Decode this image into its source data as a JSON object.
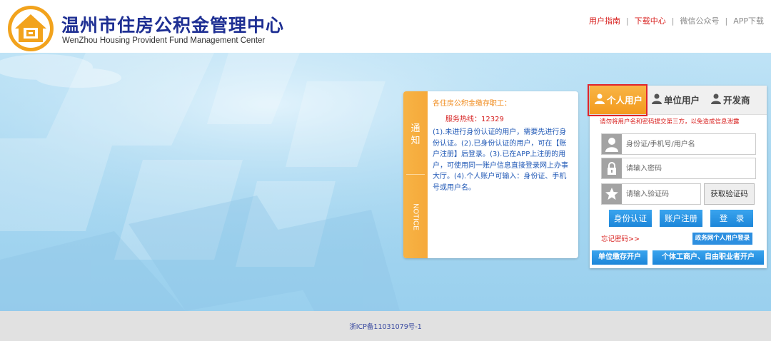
{
  "header": {
    "title_cn": "温州市住房公积金管理中心",
    "title_en": "WenZhou Housing Provident Fund Management Center",
    "links": [
      {
        "label": "用户指南",
        "color": "#d8211f"
      },
      {
        "label": "下载中心",
        "color": "#d8211f"
      },
      {
        "label": "微信公众号",
        "color": "#8a8a8a"
      },
      {
        "label": "APP下载",
        "color": "#8a8a8a"
      }
    ]
  },
  "notice": {
    "tab_cn": "通知",
    "tab_en": "NOTICE",
    "heading": "各住房公积金缴存职工：",
    "hotline": "服务热线：12329",
    "body": "(1).未进行身份认证的用户，需要先进行身份认证。(2).已身份认证的用户，可在【账户注册】后登录。(3).已在APP上注册的用户，可使用同一账户信息直接登录网上办事大厅。(4).个人账户可输入：身份证、手机号或用户名。"
  },
  "login": {
    "tabs": [
      "个人用户",
      "单位用户",
      "开发商"
    ],
    "warning": "请勿将用户名和密码提交第三方，以免造成信息泄露",
    "username_placeholder": "身份证/手机号/用户名",
    "password_placeholder": "请输入密码",
    "captcha_placeholder": "请输入验证码",
    "captcha_button": "获取验证码",
    "buttons": {
      "id_auth": "身份认证",
      "register": "账户注册",
      "login": "登　录",
      "forgot": "忘记密码>>",
      "gov_login": "政务网个人用户登录",
      "unit_open": "单位缴存开户",
      "individual_open": "个体工商户、自由职业者开户"
    }
  },
  "footer": {
    "icp": "浙ICP备11031079号-1"
  },
  "colors": {
    "brand_blue": "#1e2f93",
    "accent_orange": "#f39a1e",
    "button_blue": "#1c86d9",
    "alert_red": "#d8211f"
  }
}
